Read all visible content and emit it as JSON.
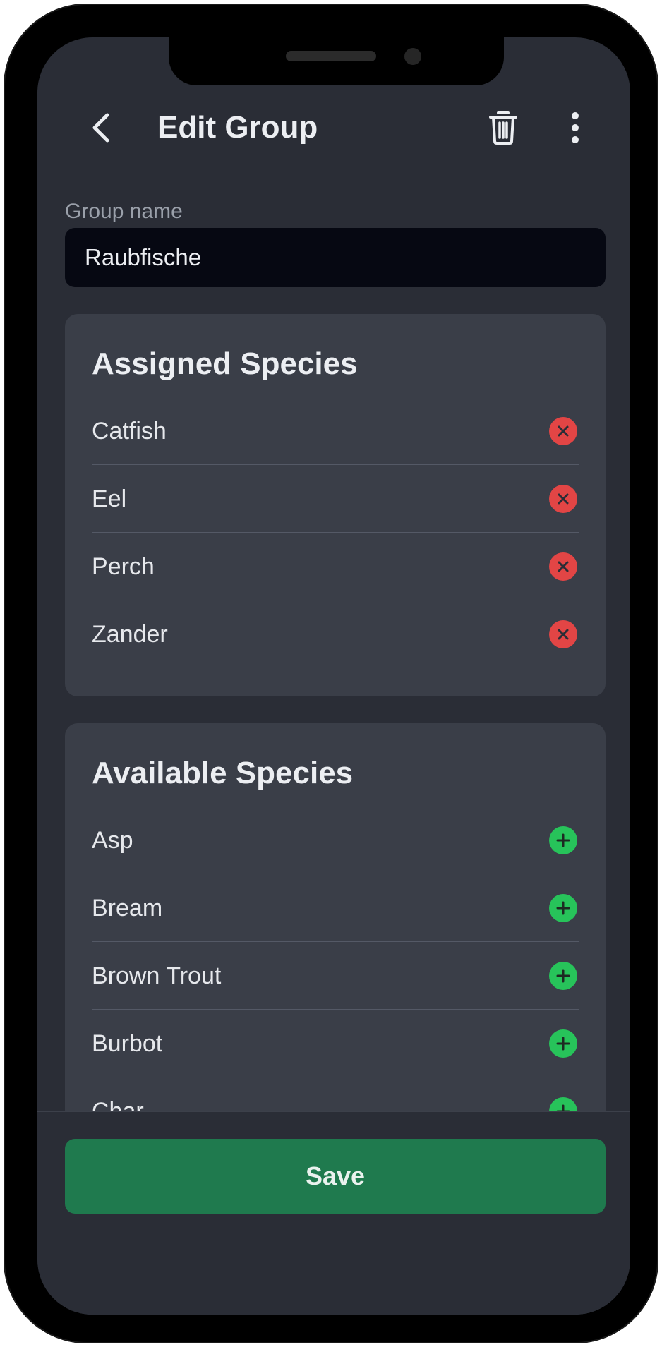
{
  "header": {
    "title": "Edit Group",
    "back_icon": "chevron-left-icon",
    "delete_icon": "trash-icon",
    "more_icon": "more-vertical-icon"
  },
  "group_name": {
    "label": "Group name",
    "value": "Raubfische"
  },
  "assigned": {
    "title": "Assigned Species",
    "items": [
      {
        "label": "Catfish"
      },
      {
        "label": "Eel"
      },
      {
        "label": "Perch"
      },
      {
        "label": "Zander"
      }
    ]
  },
  "available": {
    "title": "Available Species",
    "items": [
      {
        "label": "Asp"
      },
      {
        "label": "Bream"
      },
      {
        "label": "Brown Trout"
      },
      {
        "label": "Burbot"
      },
      {
        "label": "Char"
      }
    ]
  },
  "footer": {
    "save_label": "Save"
  },
  "colors": {
    "background": "#2a2d36",
    "card": "#3a3e48",
    "remove": "#e24545",
    "add": "#27c35a",
    "save": "#1f7a4e"
  }
}
